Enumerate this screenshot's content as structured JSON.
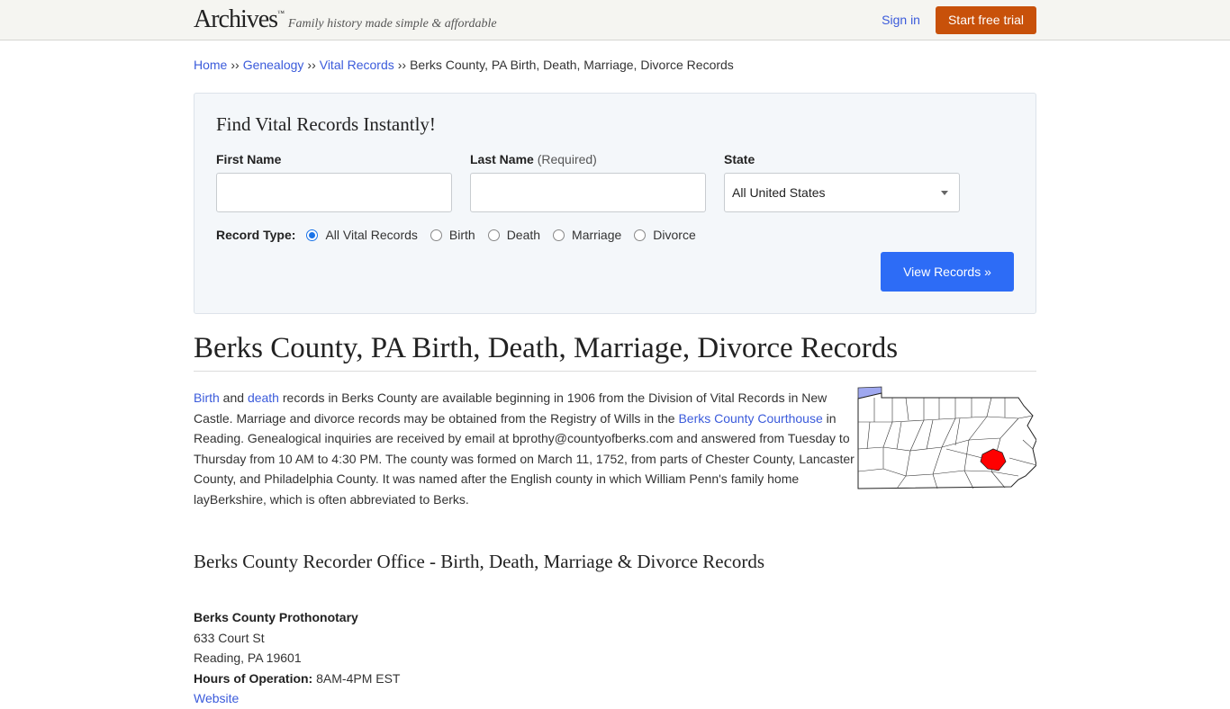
{
  "header": {
    "logo": "Archives",
    "logo_mark": "™",
    "tagline": "Family history made simple & affordable",
    "signin": "Sign in",
    "trial_button": "Start free trial"
  },
  "breadcrumb": {
    "items": [
      "Home",
      "Genealogy",
      "Vital Records"
    ],
    "separator": "››",
    "current": "Berks County, PA Birth, Death, Marriage, Divorce Records"
  },
  "search": {
    "title": "Find Vital Records Instantly!",
    "first_name_label": "First Name",
    "first_name_value": "",
    "last_name_label": "Last Name",
    "last_name_required": "(Required)",
    "last_name_value": "",
    "state_label": "State",
    "state_value": "All United States",
    "record_type_label": "Record Type:",
    "record_types": [
      {
        "label": "All Vital Records",
        "checked": true
      },
      {
        "label": "Birth",
        "checked": false
      },
      {
        "label": "Death",
        "checked": false
      },
      {
        "label": "Marriage",
        "checked": false
      },
      {
        "label": "Divorce",
        "checked": false
      }
    ],
    "submit": "View Records »"
  },
  "page_title": "Berks County, PA Birth, Death, Marriage, Divorce Records",
  "intro": {
    "link_birth": "Birth",
    "text_and": " and ",
    "link_death": "death",
    "text_1": " records in Berks County are available beginning in 1906 from the Division of Vital Records in New Castle. Marriage and divorce records may be obtained from the Registry of Wills in the ",
    "link_courthouse": "Berks County Courthouse",
    "text_2": " in Reading. Genealogical inquiries are received by email at bprothy@countyofberks.com and answered from Tuesday to Thursday from 10 AM to 4:30 PM. The county was formed on March 11, 1752, from parts of Chester County, Lancaster County, and Philadelphia County. It was named after the English county in which William Penn's family home layBerkshire, which is often abbreviated to Berks."
  },
  "map": {
    "description": "Pennsylvania county map with Berks County highlighted",
    "highlight_color": "#ff0000",
    "lake_color": "#9fa8f0"
  },
  "recorder_title": "Berks County Recorder Office - Birth, Death, Marriage & Divorce Records",
  "office": {
    "name": "Berks County Prothonotary",
    "street": "633 Court St",
    "city": "Reading, PA 19601",
    "hours_label": "Hours of Operation:",
    "hours_value": " 8AM-4PM EST",
    "website": "Website"
  }
}
